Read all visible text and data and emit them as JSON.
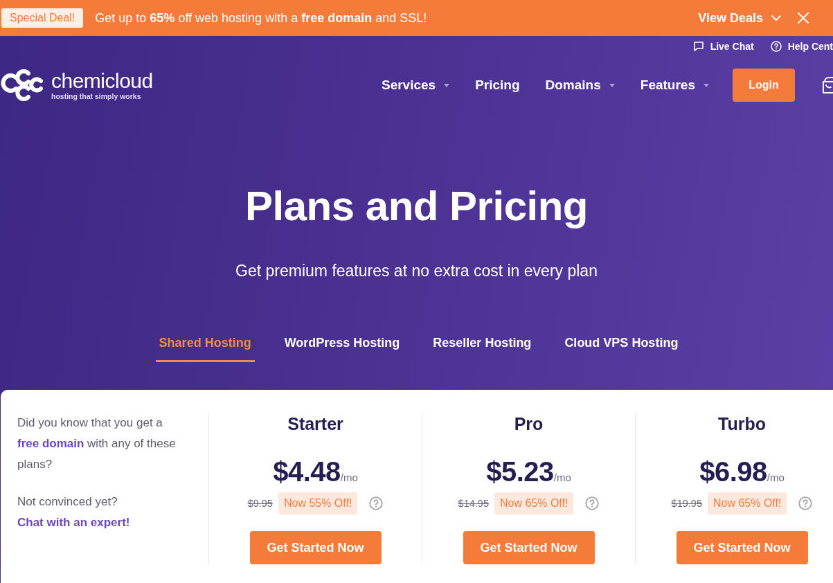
{
  "promo_bar": {
    "badge": "Special Deal!",
    "message": "Get up to **65%** off web hosting with a **free domain** and SSL!",
    "link": "View Deals"
  },
  "utility_links": [
    {
      "label": "Live Chat",
      "kind": "chat"
    },
    {
      "label": "Help Cent",
      "kind": "help"
    }
  ],
  "logo": {
    "name": "chemicloud",
    "tagline": "hosting that simply works"
  },
  "nav": {
    "items": [
      {
        "label": "Services",
        "has_menu": true
      },
      {
        "label": "Pricing",
        "has_menu": false
      },
      {
        "label": "Domains",
        "has_menu": true
      },
      {
        "label": "Features",
        "has_menu": true
      }
    ],
    "login": "Login"
  },
  "hero": {
    "title": "Plans and Pricing",
    "subtitle": "Get premium features at no extra cost in every plan"
  },
  "tabs": [
    {
      "label": "Shared Hosting",
      "selected": true
    },
    {
      "label": "WordPress Hosting",
      "selected": false
    },
    {
      "label": "Reseller Hosting",
      "selected": false
    },
    {
      "label": "Cloud VPS Hosting",
      "selected": false
    }
  ],
  "info": {
    "text": "Did you know that you get a **free domain** with any of these plans?",
    "question": "Not convinced yet?",
    "link": "Chat with an expert!"
  },
  "plans": [
    {
      "name": "Starter",
      "price": "$4.48",
      "period": "/mo",
      "old_price": "$9.95",
      "discount": "Now 55% Off!",
      "button": "Get Started Now"
    },
    {
      "name": "Pro",
      "price": "$5.23",
      "period": "/mo",
      "old_price": "$14.95",
      "discount": "Now 65% Off!",
      "button": "Get Started Now"
    },
    {
      "name": "Turbo",
      "price": "$6.98",
      "period": "/mo",
      "old_price": "$19.95",
      "discount": "Now 65% Off!",
      "button": "Get Started Now"
    }
  ]
}
